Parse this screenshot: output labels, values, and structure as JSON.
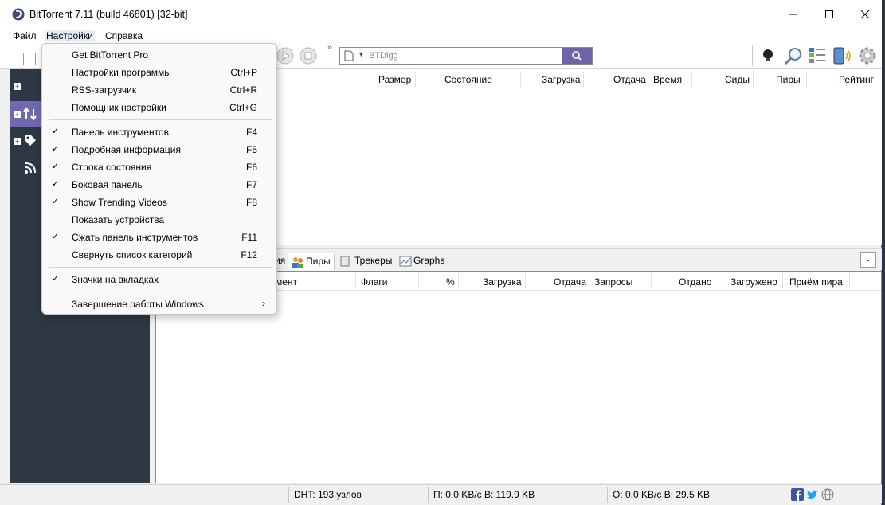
{
  "window": {
    "title": "BitTorrent 7.11  (build 46801) [32-bit]"
  },
  "menubar": {
    "items": [
      "Файл",
      "Настройки",
      "Справка"
    ]
  },
  "search": {
    "placeholder": "BTDigg"
  },
  "columns": [
    "Размер",
    "Состояние",
    "Загрузка",
    "Отдача",
    "Время",
    "Сиды",
    "Пиры",
    "Рейтинг"
  ],
  "tabs": [
    "ия",
    "Пиры",
    "Трекеры",
    "Graphs"
  ],
  "peer_columns": [
    "мент",
    "Флаги",
    "%",
    "Загрузка",
    "Отдача",
    "Запросы",
    "Отдано",
    "Загружено",
    "Приём пира"
  ],
  "status": {
    "dht": "DHT: 193 узлов",
    "down": "П: 0.0 KB/c В: 119.9 KB",
    "up": "О: 0.0 KB/c В: 29.5 KB"
  },
  "menu": {
    "items": [
      {
        "label": "Get BitTorrent Pro",
        "shortcut": "",
        "checked": false
      },
      {
        "label": "Настройки программы",
        "shortcut": "Ctrl+P",
        "checked": false
      },
      {
        "label": "RSS-загрузчик",
        "shortcut": "Ctrl+R",
        "checked": false
      },
      {
        "label": "Помощник настройки",
        "shortcut": "Ctrl+G",
        "checked": false
      },
      {
        "label": "Панель инструментов",
        "shortcut": "F4",
        "checked": true
      },
      {
        "label": "Подробная информация",
        "shortcut": "F5",
        "checked": true
      },
      {
        "label": "Строка состояния",
        "shortcut": "F6",
        "checked": true
      },
      {
        "label": "Боковая панель",
        "shortcut": "F7",
        "checked": true
      },
      {
        "label": "Show Trending Videos",
        "shortcut": "F8",
        "checked": true
      },
      {
        "label": "Показать устройства",
        "shortcut": "",
        "checked": false
      },
      {
        "label": "Сжать панель инструментов",
        "shortcut": "F11",
        "checked": true
      },
      {
        "label": "Свернуть список категорий",
        "shortcut": "F12",
        "checked": false
      },
      {
        "label": "Значки на вкладках",
        "shortcut": "",
        "checked": true
      },
      {
        "label": "Завершение работы Windows",
        "shortcut": "",
        "checked": false,
        "submenu": true
      }
    ]
  }
}
